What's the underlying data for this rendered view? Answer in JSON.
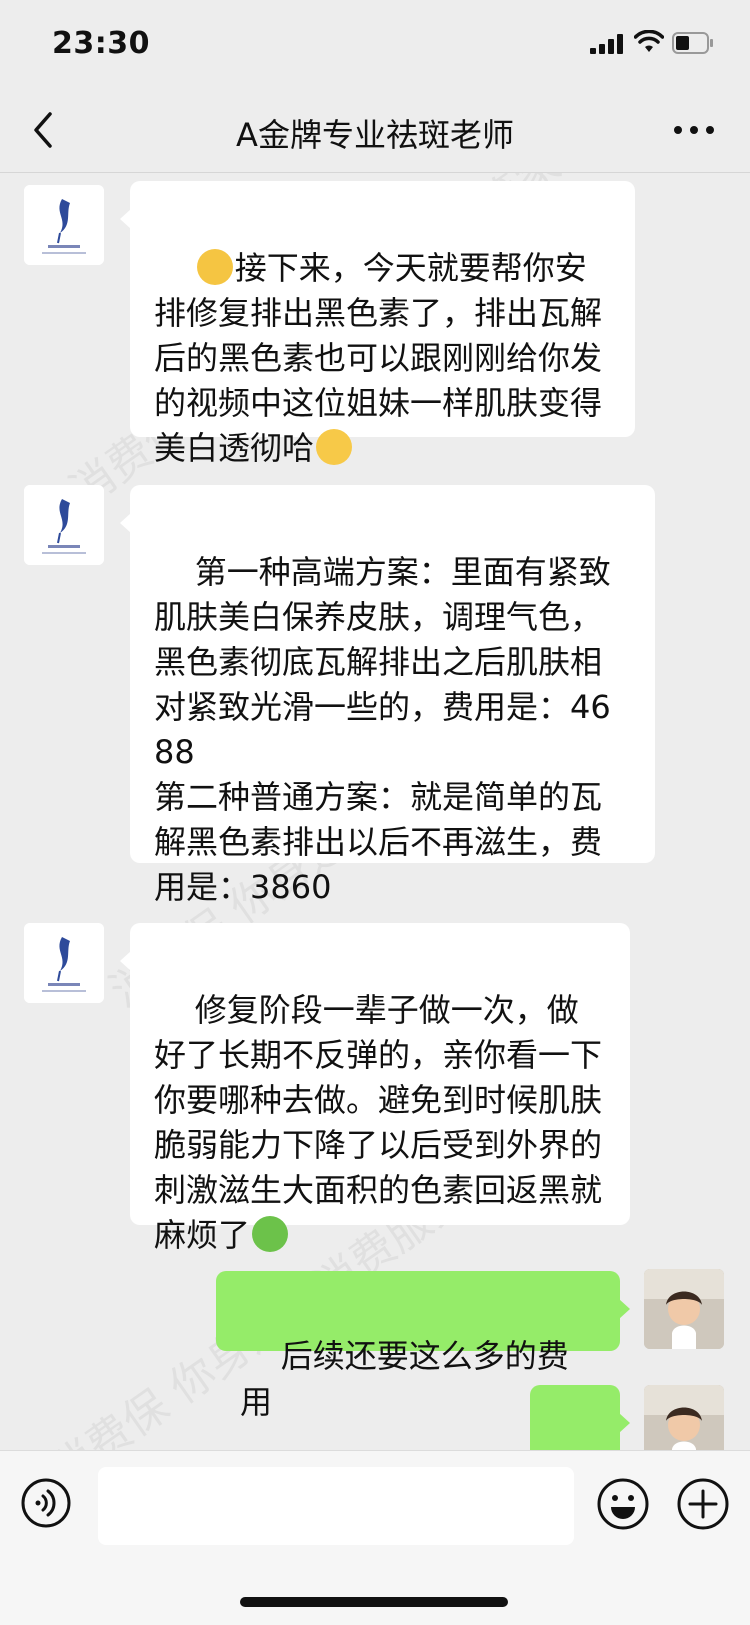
{
  "status_bar": {
    "time": "23:30"
  },
  "header": {
    "title": "A金牌专业祛斑老师"
  },
  "watermark": {
    "text": "消费保  你身边的消费服务管家"
  },
  "messages": [
    {
      "from": "other",
      "text_before": "",
      "emoji_lead": "ok-hand-emoji",
      "text": "接下来，今天就要帮你安排修复排出黑色素了，排出瓦解后的黑色素也可以跟刚刚给你发的视频中这位姐妹一样肌肤变得美白透彻哈",
      "emoji_tail": "thinking-face-emoji"
    },
    {
      "from": "other",
      "text": "第一种高端方案：里面有紧致肌肤美白保养皮肤，调理气色，黑色素彻底瓦解排出之后肌肤相对紧致光滑一些的，费用是：4688\n第二种普通方案：就是简单的瓦解黑色素排出以后不再滋生，费用是：3860"
    },
    {
      "from": "other",
      "text": "修复阶段一辈子做一次，做好了长期不反弹的，亲你看一下你要哪种去做。避免到时候肌肤脆弱能力下降了以后受到外界的刺激滋生大面积的色素回返黑就麻烦了",
      "emoji_tail": "green-person-emoji"
    },
    {
      "from": "me",
      "text": "后续还要这么多的费用"
    },
    {
      "from": "me",
      "text": "?"
    }
  ],
  "input": {
    "placeholder": ""
  },
  "colors": {
    "background": "#ededed",
    "my_bubble": "#95ec69",
    "their_bubble": "#ffffff"
  }
}
